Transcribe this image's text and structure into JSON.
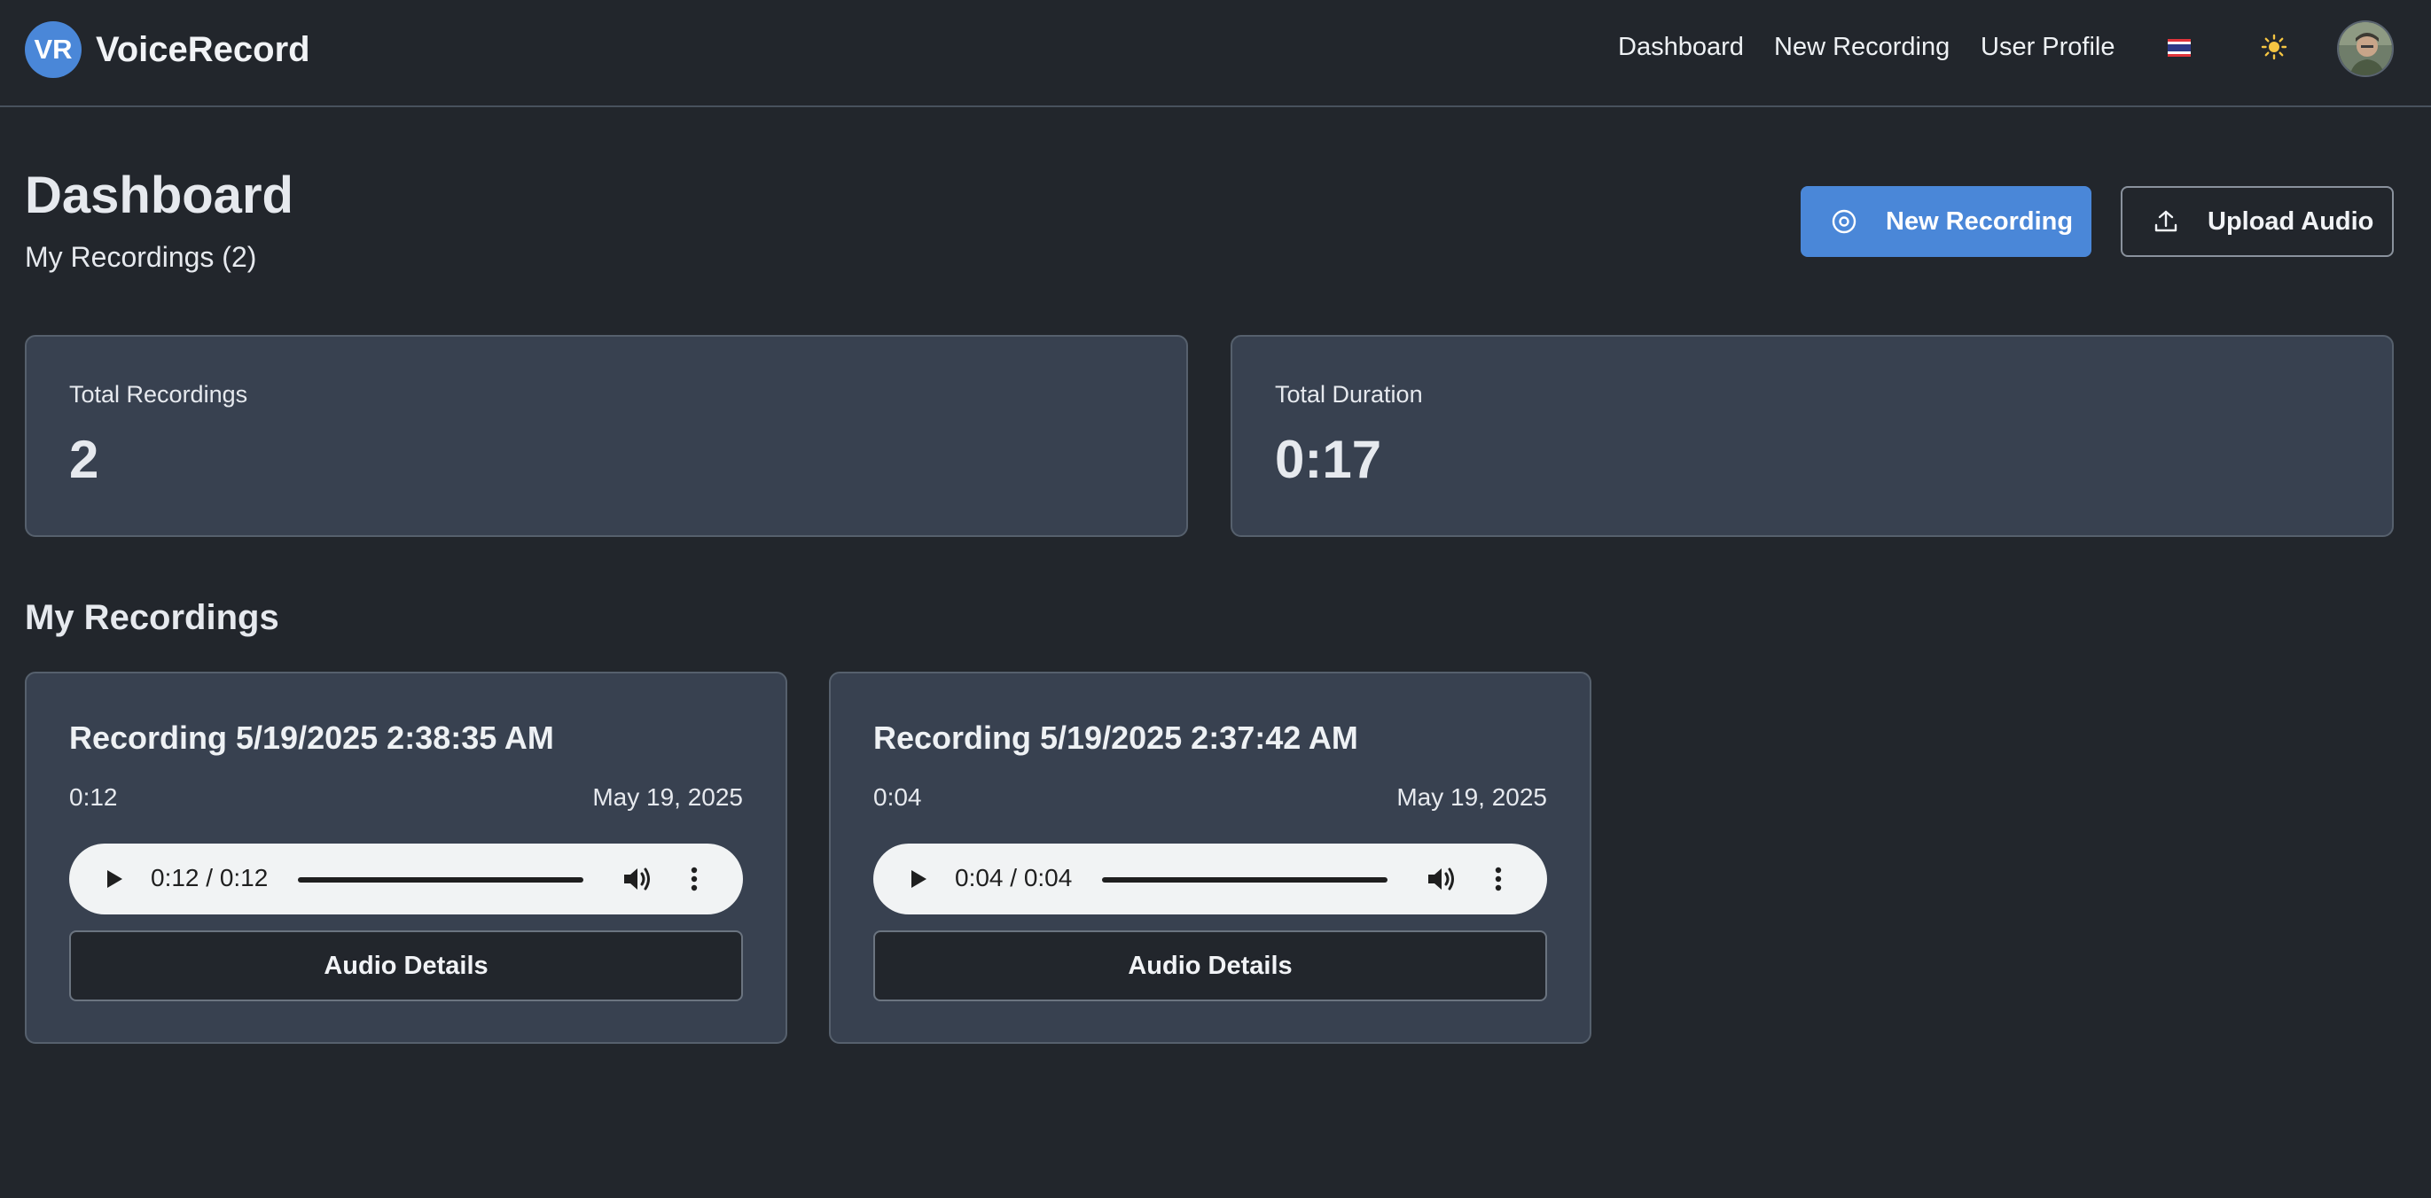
{
  "brand": {
    "logo_text": "VR",
    "name": "VoiceRecord",
    "logo_color": "#4a87d8"
  },
  "nav": {
    "links": [
      "Dashboard",
      "New Recording",
      "User Profile"
    ],
    "language_icon": "thai-flag-icon",
    "theme_icon": "sun-icon",
    "avatar_icon": "user-avatar"
  },
  "header": {
    "title": "Dashboard",
    "subtitle": "My Recordings (2)",
    "new_recording_label": "New Recording",
    "upload_label": "Upload Audio",
    "accent_color": "#4a87d8"
  },
  "stats": [
    {
      "label": "Total Recordings",
      "value": "2"
    },
    {
      "label": "Total Duration",
      "value": "0:17"
    }
  ],
  "recordings": {
    "title": "My Recordings",
    "items": [
      {
        "title": "Recording 5/19/2025 2:38:35 AM",
        "duration": "0:12",
        "date": "May 19, 2025",
        "player_time": "0:12 / 0:12",
        "progress": 1.0,
        "details_label": "Audio Details"
      },
      {
        "title": "Recording 5/19/2025 2:37:42 AM",
        "duration": "0:04",
        "date": "May 19, 2025",
        "player_time": "0:04 / 0:04",
        "progress": 1.0,
        "details_label": "Audio Details"
      }
    ]
  }
}
